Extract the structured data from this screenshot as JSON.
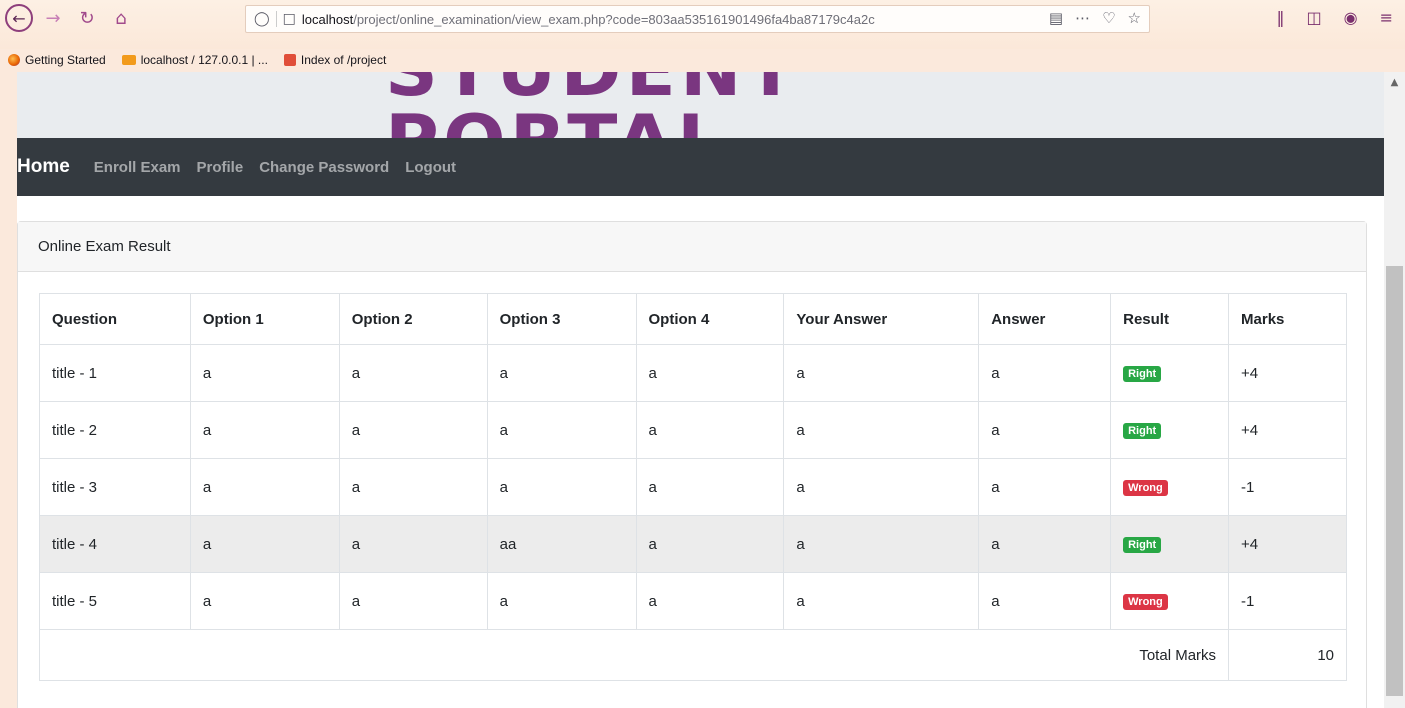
{
  "browser": {
    "url_host": "localhost",
    "url_path": "/project/online_examination/view_exam.php?code=803aa535161901496fa4ba87179c4a2c",
    "bookmarks": [
      {
        "label": "Getting Started"
      },
      {
        "label": "localhost / 127.0.0.1 | ..."
      },
      {
        "label": "Index of /project"
      }
    ]
  },
  "banner": {
    "title": "STUDENT PORTAL"
  },
  "navbar": {
    "brand": "Home",
    "links": [
      "Enroll Exam",
      "Profile",
      "Change Password",
      "Logout"
    ]
  },
  "card": {
    "header": "Online Exam Result",
    "columns": [
      "Question",
      "Option 1",
      "Option 2",
      "Option 3",
      "Option 4",
      "Your Answer",
      "Answer",
      "Result",
      "Marks"
    ],
    "rows": [
      {
        "question": "title - 1",
        "opt1": "a",
        "opt2": "a",
        "opt3": "a",
        "opt4": "a",
        "your_answer": "a",
        "answer": "a",
        "result": "Right",
        "marks": "+4"
      },
      {
        "question": "title - 2",
        "opt1": "a",
        "opt2": "a",
        "opt3": "a",
        "opt4": "a",
        "your_answer": "a",
        "answer": "a",
        "result": "Right",
        "marks": "+4"
      },
      {
        "question": "title - 3",
        "opt1": "a",
        "opt2": "a",
        "opt3": "a",
        "opt4": "a",
        "your_answer": "a",
        "answer": "a",
        "result": "Wrong",
        "marks": "-1"
      },
      {
        "question": "title - 4",
        "opt1": "a",
        "opt2": "a",
        "opt3": "aa",
        "opt4": "a",
        "your_answer": "a",
        "answer": "a",
        "result": "Right",
        "marks": "+4"
      },
      {
        "question": "title - 5",
        "opt1": "a",
        "opt2": "a",
        "opt3": "a",
        "opt4": "a",
        "your_answer": "a",
        "answer": "a",
        "result": "Wrong",
        "marks": "-1"
      }
    ],
    "total_label": "Total Marks",
    "total_value": "10"
  },
  "colors": {
    "navbar": "#343a40",
    "right_badge": "#28a745",
    "wrong_badge": "#dc3545",
    "banner_text": "#7a3680"
  }
}
